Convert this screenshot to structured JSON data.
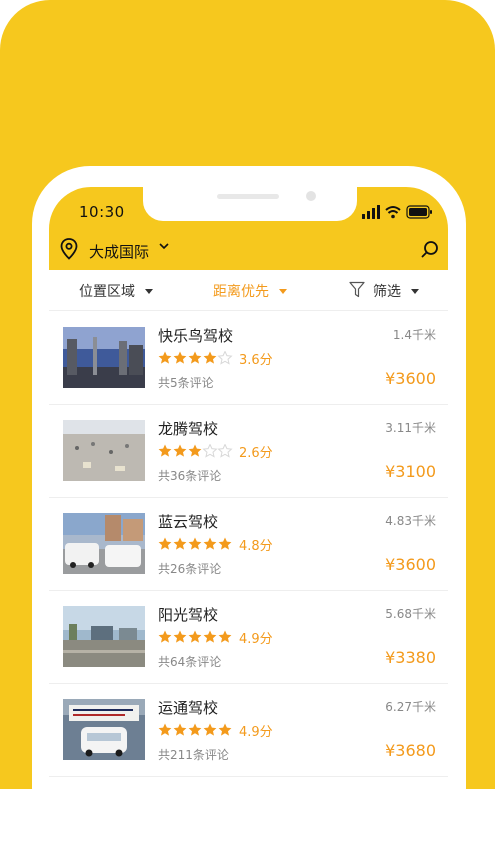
{
  "status_bar": {
    "time": "10:30"
  },
  "location": {
    "label": "大成国际"
  },
  "filters": [
    {
      "label": "位置区域",
      "active": false
    },
    {
      "label": "距离优先",
      "active": true
    },
    {
      "label": "筛选",
      "active": false
    }
  ],
  "schools": [
    {
      "name": "快乐鸟驾校",
      "rating": 4,
      "score": "3.6分",
      "reviews": "共5条评论",
      "distance": "1.4千米",
      "price": "¥3600"
    },
    {
      "name": "龙腾驾校",
      "rating": 3,
      "score": "2.6分",
      "reviews": "共36条评论",
      "distance": "3.11千米",
      "price": "¥3100"
    },
    {
      "name": "蓝云驾校",
      "rating": 5,
      "score": "4.8分",
      "reviews": "共26条评论",
      "distance": "4.83千米",
      "price": "¥3600"
    },
    {
      "name": "阳光驾校",
      "rating": 5,
      "score": "4.9分",
      "reviews": "共64条评论",
      "distance": "5.68千米",
      "price": "¥3380"
    },
    {
      "name": "运通驾校",
      "rating": 5,
      "score": "4.9分",
      "reviews": "共211条评论",
      "distance": "6.27千米",
      "price": "¥3680"
    }
  ],
  "colors": {
    "brand_yellow": "#F6C81E",
    "accent_orange": "#F39A1C",
    "star_empty": "#D8D8D8"
  },
  "icons": {
    "location": "map-pin-icon",
    "dropdown": "chevron-down-icon",
    "search": "search-icon",
    "filter": "funnel-icon",
    "star": "star-icon"
  }
}
